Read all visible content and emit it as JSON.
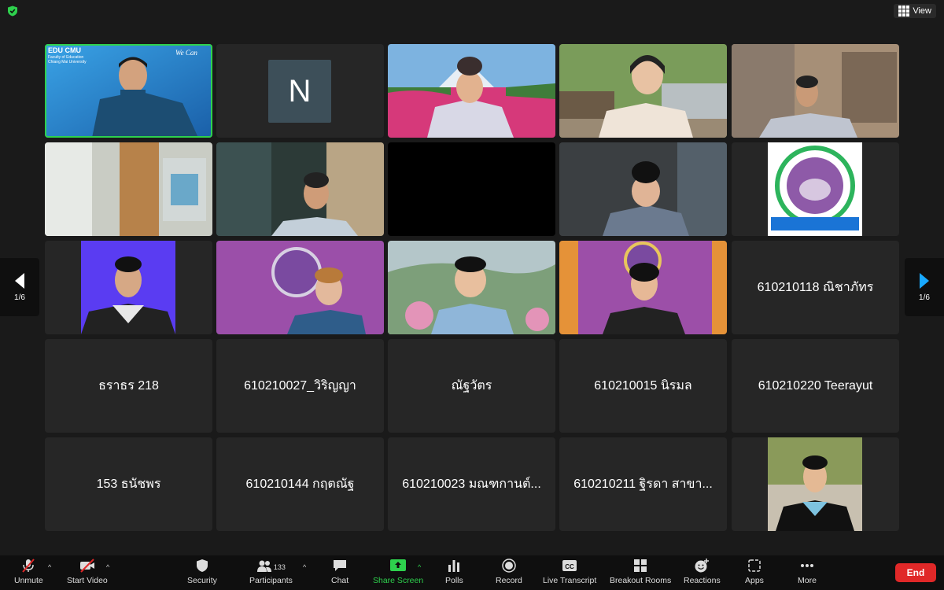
{
  "top": {
    "view_label": "View"
  },
  "tiles": [
    {
      "type": "video",
      "name": "",
      "banner": "EDU CMU",
      "banner_sub1": "Faculty of Education",
      "banner_sub2": "Chiang Mai University",
      "tag": "We Can"
    },
    {
      "type": "avatar",
      "initial": "N"
    },
    {
      "type": "video",
      "name": ""
    },
    {
      "type": "video",
      "name": ""
    },
    {
      "type": "video",
      "name": ""
    },
    {
      "type": "video",
      "name": ""
    },
    {
      "type": "video",
      "name": ""
    },
    {
      "type": "video",
      "name": ""
    },
    {
      "type": "video",
      "name": ""
    },
    {
      "type": "video",
      "name": ""
    },
    {
      "type": "video",
      "name": ""
    },
    {
      "type": "video",
      "name": ""
    },
    {
      "type": "video",
      "name": ""
    },
    {
      "type": "video",
      "name": ""
    },
    {
      "type": "text",
      "name": "610210118 ณิชาภัทร"
    },
    {
      "type": "text",
      "name": "ธราธร 218"
    },
    {
      "type": "text",
      "name": "610210027_วิริญญา"
    },
    {
      "type": "text",
      "name": "ณัฐวัตร"
    },
    {
      "type": "text",
      "name": "610210015 นิรมล"
    },
    {
      "type": "text",
      "name": "610210220 Teerayut"
    },
    {
      "type": "text",
      "name": "153 ธนัชพร"
    },
    {
      "type": "text",
      "name": "610210144 กฤตณัฐ"
    },
    {
      "type": "text",
      "name": "610210023 มณฑกานต์..."
    },
    {
      "type": "text",
      "name": "610210211 ฐิรดา  สาขา..."
    },
    {
      "type": "video",
      "name": ""
    }
  ],
  "pager": {
    "left_label": "1/6",
    "right_label": "1/6"
  },
  "toolbar": {
    "unmute": "Unmute",
    "start_video": "Start Video",
    "security": "Security",
    "participants": "Participants",
    "participants_count": "133",
    "chat": "Chat",
    "share_screen": "Share Screen",
    "polls": "Polls",
    "record": "Record",
    "live_transcript": "Live Transcript",
    "breakout_rooms": "Breakout Rooms",
    "reactions": "Reactions",
    "apps": "Apps",
    "more": "More",
    "end": "End"
  },
  "colors": {
    "accent_green": "#2ed14d",
    "end_red": "#e02828",
    "tile_bg": "#262626"
  }
}
